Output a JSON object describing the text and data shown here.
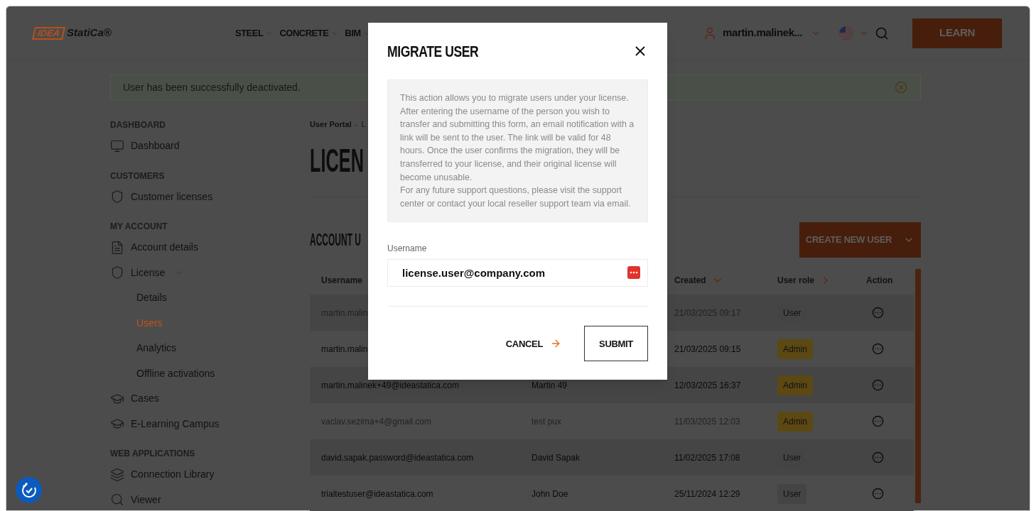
{
  "header": {
    "logo": {
      "mark": "IDEA",
      "name": "StatiCa®"
    },
    "nav": [
      {
        "label": "STEEL"
      },
      {
        "label": "CONCRETE"
      },
      {
        "label": "BIM"
      }
    ],
    "user": "martin.malinek...",
    "learn_button": "LEARN"
  },
  "alert": {
    "message": "User has been successfully deactivated."
  },
  "sidebar": [
    {
      "heading": "DASHBOARD",
      "items": [
        {
          "label": "Dashboard",
          "selected": false
        }
      ]
    },
    {
      "heading": "CUSTOMERS",
      "items": [
        {
          "label": "Customer licenses",
          "selected": false
        }
      ]
    },
    {
      "heading": "MY ACCOUNT",
      "items": [
        {
          "label": "Account details",
          "selected": false
        },
        {
          "label": "License",
          "selected": false,
          "expanded": true,
          "children": [
            {
              "label": "Details",
              "selected": false
            },
            {
              "label": "Users",
              "selected": true
            },
            {
              "label": "Analytics",
              "selected": false
            },
            {
              "label": "Offline activations",
              "selected": false
            }
          ]
        },
        {
          "label": "Cases",
          "selected": false
        },
        {
          "label": "E-Learning Campus",
          "selected": false
        }
      ]
    },
    {
      "heading": "WEB APPLICATIONS",
      "items": [
        {
          "label": "Connection Library",
          "selected": false
        },
        {
          "label": "Viewer",
          "selected": false
        }
      ]
    }
  ],
  "main": {
    "breadcrumb": [
      "User Portal",
      "L"
    ],
    "breadcrumb_separator": "-",
    "title": "LICEN",
    "section_title": "ACCOUNT U",
    "create_button": "CREATE NEW USER",
    "table": {
      "columns": [
        "Username",
        "Created",
        "User role",
        "Action"
      ],
      "rows": [
        {
          "username": "martin.malin",
          "created": "21/03/2025 09:17",
          "role": "User",
          "kind": "user",
          "inactive": true
        },
        {
          "username": "martin.malin",
          "created": "21/03/2025 09:15",
          "role": "Admin",
          "kind": "admin",
          "inactive": false
        },
        {
          "username": "martin.malinek+49@ideastatica.com",
          "name": "Martin 49",
          "created": "12/03/2025 16:37",
          "role": "Admin",
          "kind": "admin",
          "inactive": false
        },
        {
          "username": "vaclav.sezima+4@gmail.com",
          "name": "test pux",
          "created": "11/03/2025 12:03",
          "role": "Admin",
          "kind": "admin",
          "inactive": true
        },
        {
          "username": "david.sapak.password@ideastatica.com",
          "name": "David Sapak",
          "created": "11/02/2025 17:08",
          "role": "User",
          "kind": "user",
          "inactive": false
        },
        {
          "username": "trialtestuser@ideastatica.com",
          "name": "John Doe",
          "created": "25/11/2024 12:29",
          "role": "User",
          "kind": "user",
          "inactive": false
        }
      ]
    }
  },
  "dialog": {
    "title": "MIGRATE USER",
    "info": [
      "This action allows you to migrate users under your license. After entering the username of the person you wish to transfer and submitting this form, an email notification with a link will be sent to the user. The link will be valid for 48 hours. Once the user confirms the migration, they will be transferred to your license, and their original license will become unusable.",
      "For any future support questions, please visit the support center or contact your local reseller support team via email."
    ],
    "field": {
      "label": "Username",
      "value": "license.user@company.com"
    },
    "cancel": "CANCEL",
    "submit": "SUBMIT"
  }
}
